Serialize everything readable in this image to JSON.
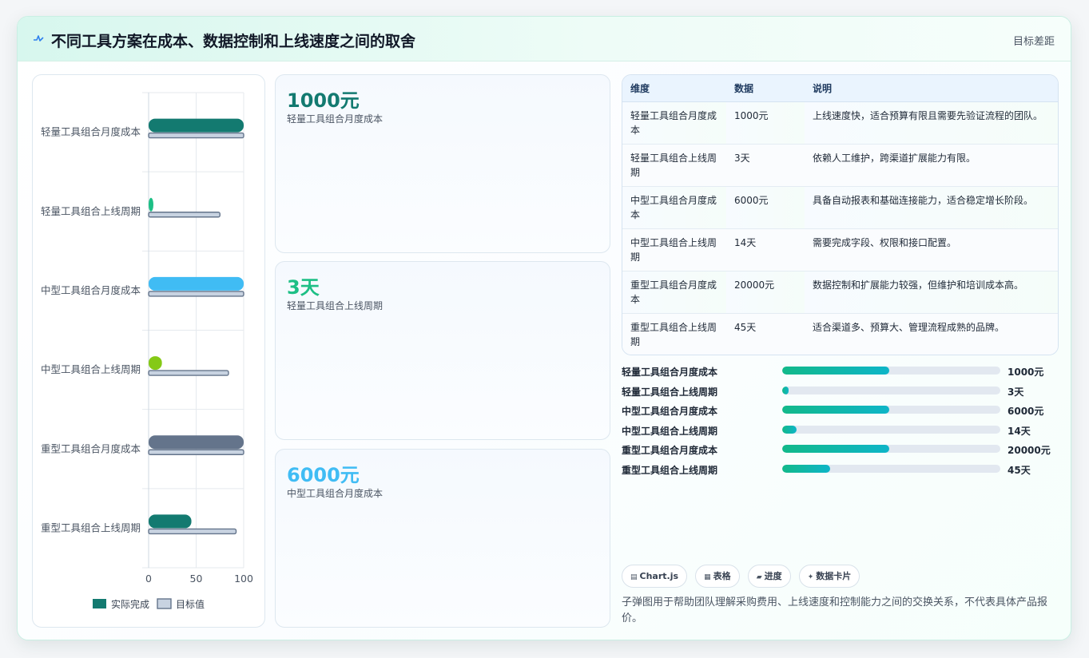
{
  "header": {
    "title": "不同工具方案在成本、数据控制和上线速度之间的取舍",
    "link": "目标差距"
  },
  "colors": {
    "teal": "#137a70",
    "green": "#1dbf85",
    "sky": "#40bcf4",
    "lime": "#85c916",
    "slate": "#64748b",
    "target": "#c8d3e1"
  },
  "chart_data": {
    "type": "bar",
    "orientation": "horizontal",
    "categories": [
      "轻量工具组合月度成本",
      "轻量工具组合上线周期",
      "中型工具组合月度成本",
      "中型工具组合上线周期",
      "重型工具组合月度成本",
      "重型工具组合上线周期"
    ],
    "series": [
      {
        "name": "实际完成",
        "values": [
          100,
          5,
          100,
          14,
          100,
          45
        ]
      },
      {
        "name": "目标值",
        "values": [
          100,
          75,
          100,
          84,
          100,
          92
        ]
      }
    ],
    "bar_colors": [
      "#137a70",
      "#1dbf85",
      "#40bcf4",
      "#85c916",
      "#64748b",
      "#137a70"
    ],
    "xlim": [
      0,
      100
    ],
    "xticks": [
      "0",
      "50",
      "100"
    ],
    "legend": [
      "实际完成",
      "目标值"
    ],
    "legend_position": "bottom",
    "grid": true
  },
  "kpis": [
    {
      "value": "1000元",
      "label": "轻量工具组合月度成本",
      "color": "#137a70"
    },
    {
      "value": "3天",
      "label": "轻量工具组合上线周期",
      "color": "#1dbf85"
    },
    {
      "value": "6000元",
      "label": "中型工具组合月度成本",
      "color": "#40bcf4"
    }
  ],
  "table": {
    "headers": [
      "维度",
      "数据",
      "说明"
    ],
    "rows": [
      [
        "轻量工具组合月度成本",
        "1000元",
        "上线速度快，适合预算有限且需要先验证流程的团队。"
      ],
      [
        "轻量工具组合上线周期",
        "3天",
        "依赖人工维护，跨渠道扩展能力有限。"
      ],
      [
        "中型工具组合月度成本",
        "6000元",
        "具备自动报表和基础连接能力，适合稳定增长阶段。"
      ],
      [
        "中型工具组合上线周期",
        "14天",
        "需要完成字段、权限和接口配置。"
      ],
      [
        "重型工具组合月度成本",
        "20000元",
        "数据控制和扩展能力较强，但维护和培训成本高。"
      ],
      [
        "重型工具组合上线周期",
        "45天",
        "适合渠道多、预算大、管理流程成熟的品牌。"
      ]
    ]
  },
  "progress": [
    {
      "label": "轻量工具组合月度成本",
      "value": "1000元",
      "fraction": 0.49
    },
    {
      "label": "轻量工具组合上线周期",
      "value": "3天",
      "fraction": 0.03
    },
    {
      "label": "中型工具组合月度成本",
      "value": "6000元",
      "fraction": 0.49
    },
    {
      "label": "中型工具组合上线周期",
      "value": "14天",
      "fraction": 0.065
    },
    {
      "label": "重型工具组合月度成本",
      "value": "20000元",
      "fraction": 0.49
    },
    {
      "label": "重型工具组合上线周期",
      "value": "45天",
      "fraction": 0.22
    }
  ],
  "chips": [
    {
      "icon": "▤",
      "label": "Chart.js"
    },
    {
      "icon": "▦",
      "label": "表格"
    },
    {
      "icon": "▰",
      "label": "进度"
    },
    {
      "icon": "✦",
      "label": "数据卡片"
    }
  ],
  "footnote": "子弹图用于帮助团队理解采购费用、上线速度和控制能力之间的交换关系，不代表具体产品报价。"
}
